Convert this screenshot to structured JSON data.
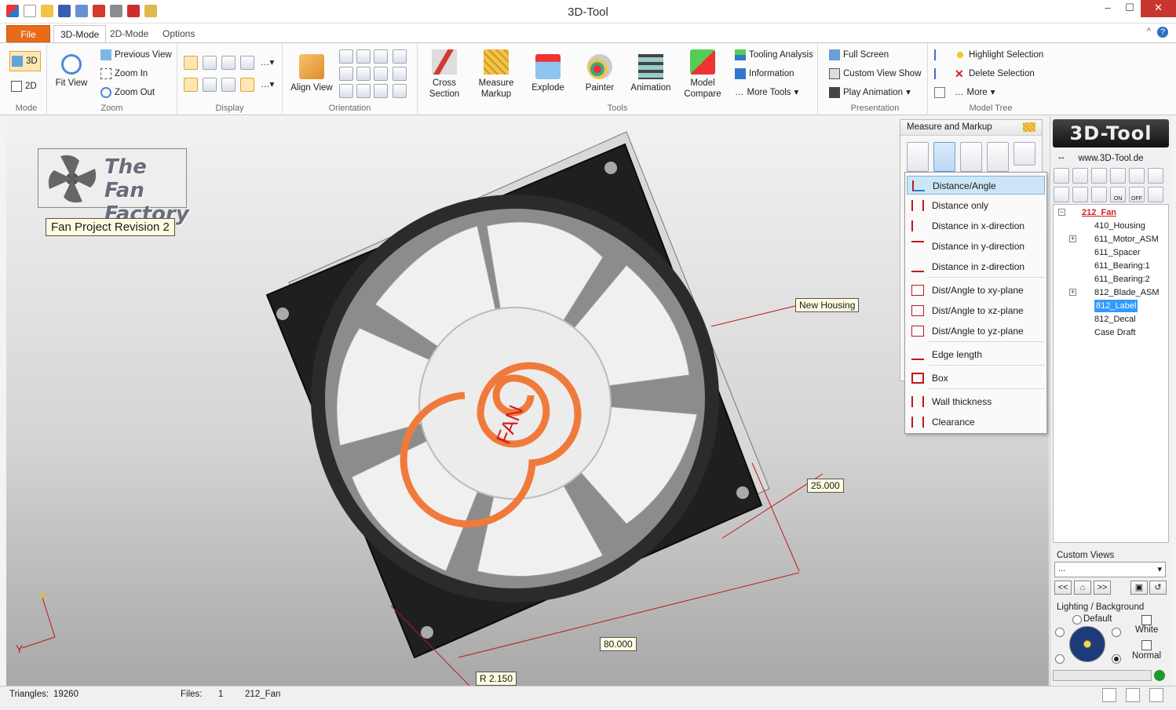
{
  "window": {
    "title": "3D-Tool",
    "min": "–",
    "max": "☐",
    "close": "✕"
  },
  "tabs": {
    "file": "File",
    "mode3d": "3D-Mode",
    "mode2d": "2D-Mode",
    "options": "Options",
    "collapse": "^",
    "help": "?"
  },
  "ribbon": {
    "mode": {
      "label": "Mode",
      "btn3d": "3D",
      "btn2d": "2D"
    },
    "zoom": {
      "label": "Zoom",
      "fit_view": "Fit View",
      "previous_view": "Previous View",
      "zoom_in": "Zoom In",
      "zoom_out": "Zoom Out"
    },
    "display": {
      "label": "Display"
    },
    "orientation": {
      "label": "Orientation",
      "align_view": "Align View"
    },
    "tools": {
      "label": "Tools",
      "cross_section_1": "Cross",
      "cross_section_2": "Section",
      "measure_1": "Measure",
      "measure_2": "Markup",
      "explode": "Explode",
      "painter": "Painter",
      "animation": "Animation",
      "compare_1": "Model",
      "compare_2": "Compare",
      "tooling": "Tooling Analysis",
      "information": "Information",
      "more_tools": "More Tools"
    },
    "presentation": {
      "label": "Presentation",
      "full_screen": "Full Screen",
      "custom_show": "Custom View Show",
      "play_animation": "Play Animation"
    },
    "model_tree": {
      "label": "Model Tree",
      "highlight": "Highlight Selection",
      "delete": "Delete Selection",
      "more": "More"
    }
  },
  "viewport": {
    "logo_line1": "The Fan",
    "logo_line2": "Factory",
    "project_label": "Fan Project Revision 2",
    "callout_housing": "New Housing",
    "dim_25": "25.000",
    "dim_80": "80.000",
    "dim_r": "R 2.150",
    "fan_text": "FAN",
    "axis_x": "X",
    "axis_y": "Y"
  },
  "measure_panel": {
    "title": "Measure and Markup",
    "items": [
      "Distance/Angle",
      "Distance only",
      "Distance in x-direction",
      "Distance in y-direction",
      "Distance in z-direction",
      "Dist/Angle to xy-plane",
      "Dist/Angle to xz-plane",
      "Dist/Angle to yz-plane",
      "Edge length",
      "Box",
      "Wall thickness",
      "Clearance"
    ]
  },
  "right_panel": {
    "brand": "3D-Tool",
    "www": "www.3D-Tool.de",
    "on": "ON",
    "off": "OFF",
    "tree": [
      {
        "label": "212_Fan",
        "root": true
      },
      {
        "label": "410_Housing"
      },
      {
        "label": "611_Motor_ASM",
        "expandable": true
      },
      {
        "label": "611_Spacer"
      },
      {
        "label": "611_Bearing:1"
      },
      {
        "label": "611_Bearing:2"
      },
      {
        "label": "812_Blade_ASM",
        "expandable": true
      },
      {
        "label": "812_Label",
        "selected": true
      },
      {
        "label": "812_Decal"
      },
      {
        "label": "Case Draft"
      }
    ],
    "custom_views_label": "Custom Views",
    "custom_views_value": "...",
    "nav_prev": "<<",
    "nav_next": ">>",
    "lighting_label": "Lighting / Background",
    "default_label": "Default",
    "white_label": "White",
    "normal_label": "Normal"
  },
  "status": {
    "triangles_label": "Triangles:",
    "triangles_value": "19260",
    "files_label": "Files:",
    "files_value": "1",
    "file_name": "212_Fan"
  },
  "colors": {
    "accent": "#e86b1c",
    "selection": "#3399ff",
    "highlight": "#cde6f7",
    "fan_spiral": "#f07a3b",
    "dim_line": "#c01818"
  }
}
